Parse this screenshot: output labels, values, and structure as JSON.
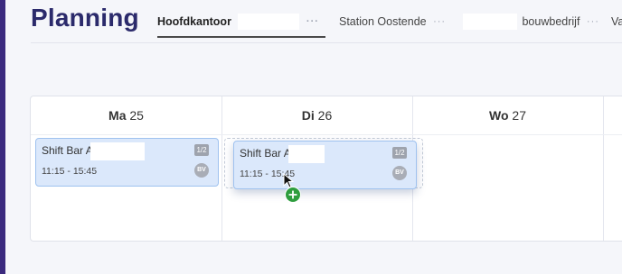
{
  "app": {
    "title": "Planning",
    "accent_color": "#3b2a7e",
    "title_color": "#2b2a6b"
  },
  "tabs": [
    {
      "label": "Hoofdkantoor",
      "active": true,
      "has_more": true
    },
    {
      "label": "Station Oostende",
      "active": false,
      "has_more": true
    },
    {
      "label": "bouwbedrijf",
      "active": false,
      "has_more": true
    },
    {
      "label": "Va",
      "active": false,
      "has_more": false
    }
  ],
  "tab_more_glyph": "···",
  "days": [
    {
      "name": "Ma",
      "date": "25"
    },
    {
      "name": "Di",
      "date": "26"
    },
    {
      "name": "Wo",
      "date": "27"
    }
  ],
  "shifts": [
    {
      "day": "Ma",
      "title": "Shift Bar A",
      "time": "11:15 - 15:45",
      "count": "1/2",
      "assignee_initials": "BV",
      "state": "placed"
    },
    {
      "day": "Di",
      "title": "Shift Bar A",
      "time": "11:15 - 15:45",
      "count": "1/2",
      "assignee_initials": "BV",
      "state": "dragging"
    }
  ],
  "drag_feedback": {
    "cursor_icon": "pointer-arrow-icon",
    "badge_icon": "plus-circle-icon",
    "badge_color": "#2e9d3e"
  },
  "colors": {
    "card_bg": "#dbe8fb",
    "card_border": "#9fc2ef",
    "badge_gray": "#9ea3ad"
  }
}
